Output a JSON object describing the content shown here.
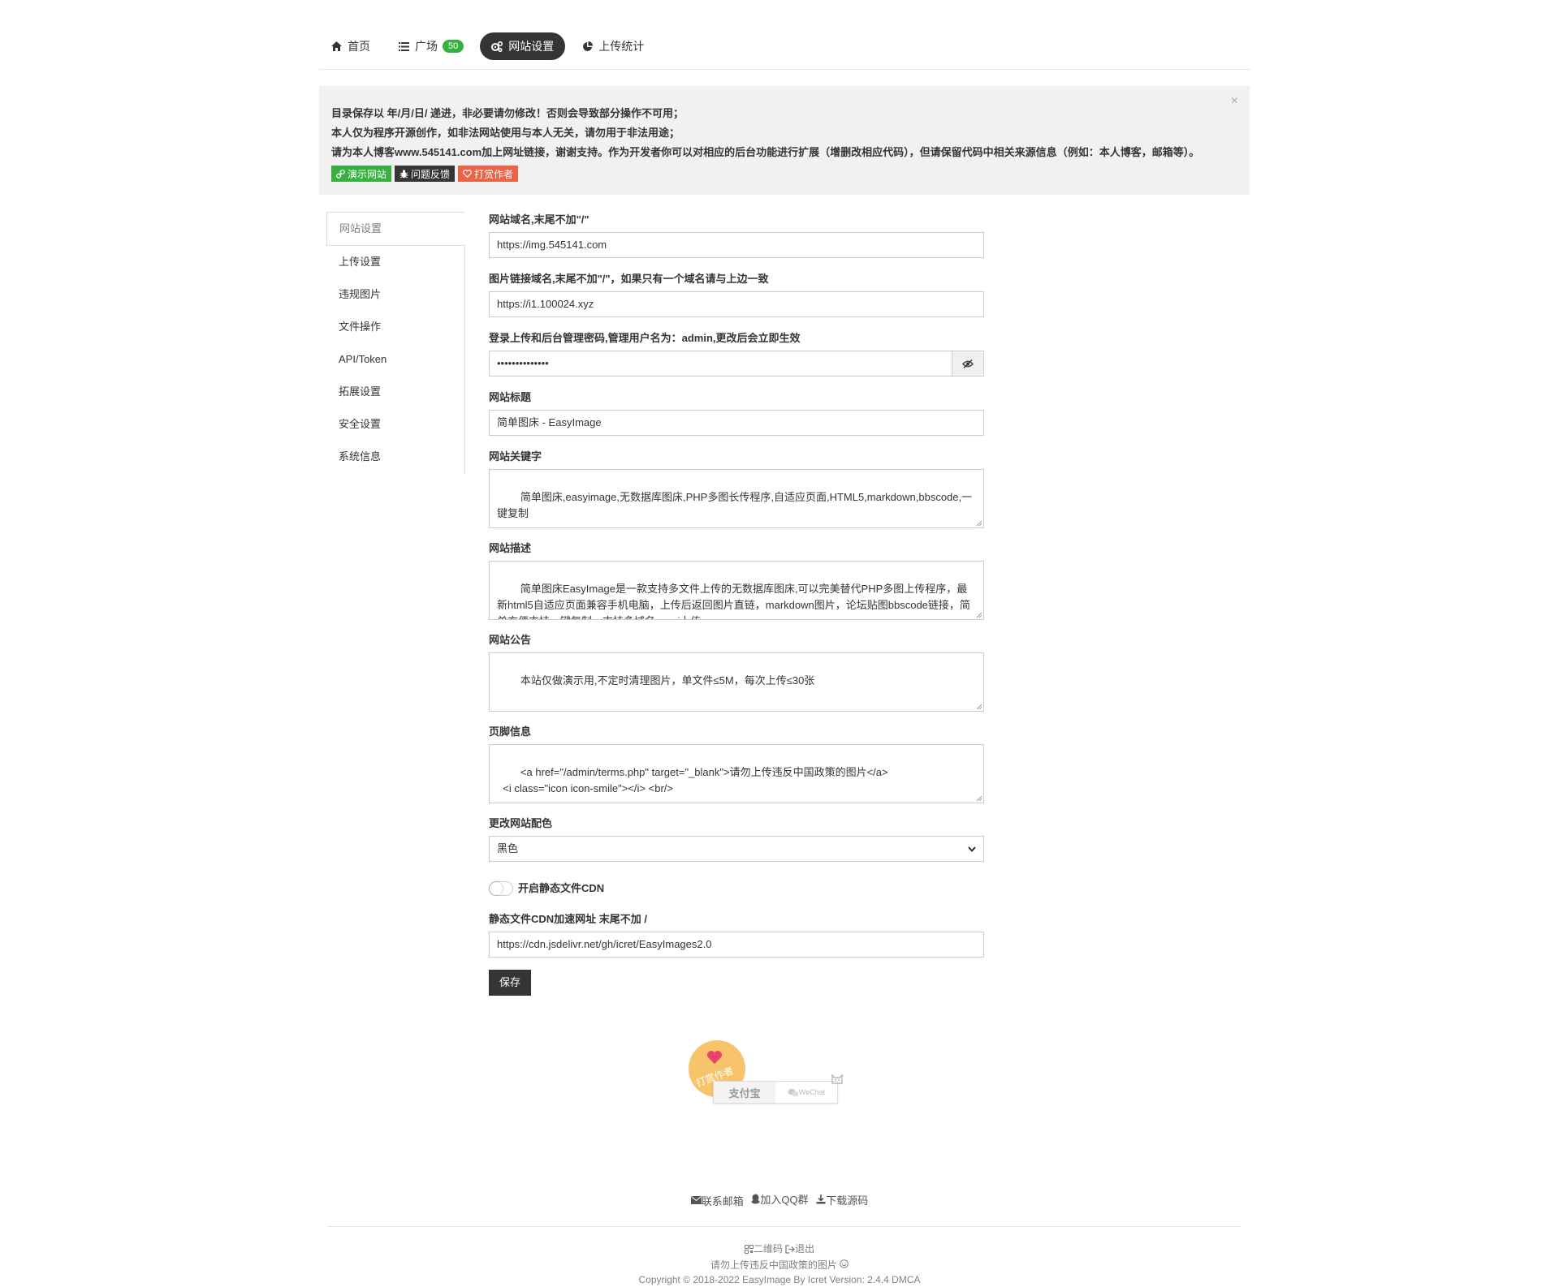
{
  "nav": {
    "items": [
      {
        "label": "首页",
        "icon": "home-icon"
      },
      {
        "label": "广场",
        "icon": "list-icon",
        "badge": "50"
      },
      {
        "label": "网站设置",
        "icon": "cogs-icon",
        "active": true
      },
      {
        "label": "上传统计",
        "icon": "pie-chart-icon"
      }
    ]
  },
  "alert": {
    "line1": "目录保存以 年/月/日/ 递进，非必要请勿修改！否则会导致部分操作不可用；",
    "line2": "本人仅为程序开源创作，如非法网站使用与本人无关，请勿用于非法用途；",
    "line3": "请为本人博客www.545141.com加上网址链接，谢谢支持。作为开发者你可以对相应的后台功能进行扩展（增删改相应代码），但请保留代码中相关来源信息（例如：本人博客，邮箱等）。",
    "close": "×",
    "demo_label": "演示网站",
    "feedback_label": "问题反馈",
    "donate_label": "打赏作者"
  },
  "sidebar": {
    "items": [
      "网站设置",
      "上传设置",
      "违规图片",
      "文件操作",
      "API/Token",
      "拓展设置",
      "安全设置",
      "系统信息"
    ]
  },
  "form": {
    "domain_label": "网站域名,末尾不加\"/\"",
    "domain_value": "https://img.545141.com",
    "imgurl_label": "图片链接域名,末尾不加\"/\"，如果只有一个域名请与上边一致",
    "imgurl_value": "https://i1.100024.xyz",
    "password_label": "登录上传和后台管理密码,管理用户名为：admin,更改后会立即生效",
    "password_value": "••••••••••••••",
    "title_label": "网站标题",
    "title_value": "简单图床 - EasyImage",
    "keywords_label": "网站关键字",
    "keywords_value": "简单图床,easyimage,无数据库图床,PHP多图长传程序,自适应页面,HTML5,markdown,bbscode,一键复制",
    "description_label": "网站描述",
    "description_value": "简单图床EasyImage是一款支持多文件上传的无数据库图床,可以完美替代PHP多图上传程序，最新html5自适应页面兼容手机电脑，上传后返回图片直链，markdown图片，论坛贴图bbscode链接，简单方便支持一键复制，支持多域名，api上传。",
    "notice_label": "网站公告",
    "notice_value": "本站仅做演示用,不定时清理图片，单文件≤5M，每次上传≤30张",
    "footer_label": "页脚信息",
    "footer_value": "<a href=\"/admin/terms.php\" target=\"_blank\">请勿上传违反中国政策的图片</a>\n  <i class=\"icon icon-smile\"></i> <br/>",
    "theme_label": "更改网站配色",
    "theme_value": "黑色",
    "cdn_toggle_label": "开启静态文件CDN",
    "cdn_toggle_on": false,
    "cdn_url_label": "静态文件CDN加速网址 末尾不加 /",
    "cdn_url_value": "https://cdn.jsdelivr.net/gh/icret/EasyImages2.0",
    "save_label": "保存"
  },
  "donate": {
    "badge": "打赏作者",
    "alipay": "支付宝",
    "wechat": "WeChat"
  },
  "footer": {
    "mail": "联系邮箱",
    "qq": "加入QQ群",
    "download": "下载源码",
    "qrcode": "二维码",
    "logout": "退出",
    "terms": "请勿上传违反中国政策的图片",
    "copyright": "Copyright © 2018-2022 EasyImage By Icret Version: 2.4.4 DMCA"
  },
  "colors": {
    "dark": "#353535",
    "green": "#38b03f",
    "red": "#ea644a",
    "alert_bg": "#f1f1f1",
    "donate_yellow": "#f7c46c"
  }
}
